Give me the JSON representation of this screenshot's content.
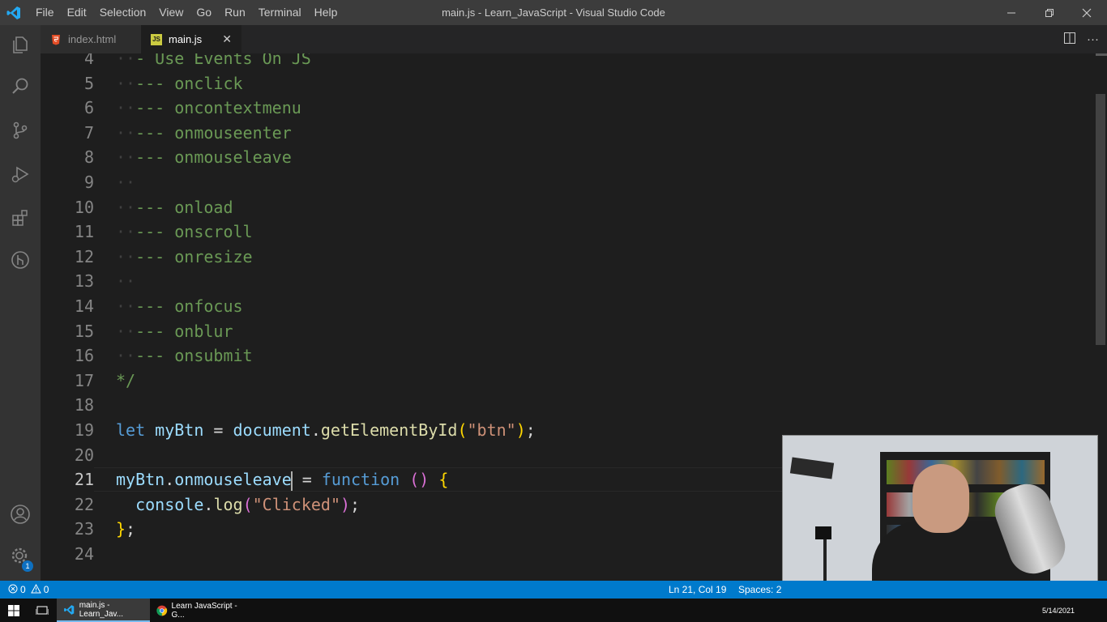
{
  "titlebar": {
    "title": "main.js - Learn_JavaScript - Visual Studio Code",
    "menu": [
      "File",
      "Edit",
      "Selection",
      "View",
      "Go",
      "Run",
      "Terminal",
      "Help"
    ]
  },
  "tabs": [
    {
      "label": "index.html",
      "icon": "html-file-icon",
      "active": false
    },
    {
      "label": "main.js",
      "icon": "js-file-icon",
      "icon_text": "JS",
      "active": true
    }
  ],
  "editor": {
    "lines": [
      {
        "n": "4",
        "code": "- Use Events On JS"
      },
      {
        "n": "5",
        "code": "--- onclick"
      },
      {
        "n": "6",
        "code": "--- oncontextmenu"
      },
      {
        "n": "7",
        "code": "--- onmouseenter"
      },
      {
        "n": "8",
        "code": "--- onmouseleave"
      },
      {
        "n": "9",
        "code": ""
      },
      {
        "n": "10",
        "code": "--- onload"
      },
      {
        "n": "11",
        "code": "--- onscroll"
      },
      {
        "n": "12",
        "code": "--- onresize"
      },
      {
        "n": "13",
        "code": ""
      },
      {
        "n": "14",
        "code": "--- onfocus"
      },
      {
        "n": "15",
        "code": "--- onblur"
      },
      {
        "n": "16",
        "code": "--- onsubmit"
      },
      {
        "n": "17",
        "code": "*/"
      },
      {
        "n": "18",
        "code": ""
      },
      {
        "n": "19",
        "tokens": [
          [
            "let",
            "c-kw"
          ],
          [
            " ",
            "c-txt"
          ],
          [
            "myBtn",
            "c-var"
          ],
          [
            " = ",
            "c-txt"
          ],
          [
            "document",
            "c-var"
          ],
          [
            ".",
            "c-txt"
          ],
          [
            "getElementById",
            "c-fn"
          ],
          [
            "(",
            "c-br"
          ],
          [
            "\"btn\"",
            "c-str"
          ],
          [
            ")",
            "c-br"
          ],
          [
            ";",
            "c-txt"
          ]
        ]
      },
      {
        "n": "20",
        "code": ""
      },
      {
        "n": "21",
        "current": true,
        "tokens": [
          [
            "myBtn",
            "c-var"
          ],
          [
            ".",
            "c-txt"
          ],
          [
            "onmouseleave",
            "c-var"
          ],
          [
            "|",
            "cursor"
          ],
          [
            " = ",
            "c-txt"
          ],
          [
            "function",
            "c-kw"
          ],
          [
            " ",
            "c-txt"
          ],
          [
            "()",
            "c-br2"
          ],
          [
            " ",
            "c-txt"
          ],
          [
            "{",
            "c-br"
          ]
        ]
      },
      {
        "n": "22",
        "tokens": [
          [
            "  ",
            "c-txt"
          ],
          [
            "console",
            "c-var"
          ],
          [
            ".",
            "c-txt"
          ],
          [
            "log",
            "c-fn"
          ],
          [
            "(",
            "c-br2"
          ],
          [
            "\"Clicked\"",
            "c-str"
          ],
          [
            ")",
            "c-br2"
          ],
          [
            ";",
            "c-txt"
          ]
        ]
      },
      {
        "n": "23",
        "tokens": [
          [
            "}",
            "c-br"
          ],
          [
            ";",
            "c-txt"
          ]
        ]
      },
      {
        "n": "24",
        "code": ""
      }
    ]
  },
  "statusbar": {
    "errors": "0",
    "warnings": "0",
    "position": "Ln 21, Col 19",
    "spaces": "Spaces: 2"
  },
  "taskbar": {
    "items": [
      {
        "label": "main.js - Learn_Jav..."
      },
      {
        "label": "Learn JavaScript - G..."
      }
    ],
    "date": "5/14/2021"
  },
  "activity": {
    "settings_badge": "1"
  }
}
